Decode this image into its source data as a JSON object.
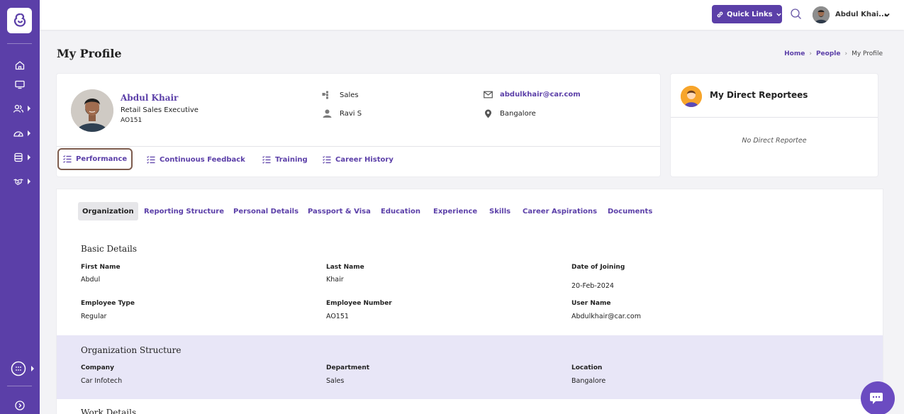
{
  "colors": {
    "brand": "#5b3fa8",
    "sidebar": "#5b3fa8",
    "band": "#e8e6f7",
    "active_border": "#7d5c4e"
  },
  "topbar": {
    "quick_links_label": "Quick Links",
    "user_name": "Abdul Khai..."
  },
  "page": {
    "title": "My Profile"
  },
  "breadcrumb": {
    "home": "Home",
    "people": "People",
    "current": "My Profile",
    "separator": "›"
  },
  "profile": {
    "name": "Abdul Khair",
    "job_title": "Retail Sales Executive",
    "employee_id": "AO151",
    "department": "Sales",
    "manager": "Ravi S",
    "email": "abdulkhair@car.com",
    "location": "Bangalore",
    "tabs": [
      "Performance",
      "Continuous Feedback",
      "Training",
      "Career History"
    ]
  },
  "reportees": {
    "title": "My Direct Reportees",
    "empty_text": "No Direct Reportee"
  },
  "details": {
    "tabs": [
      "Organization",
      "Reporting Structure",
      "Personal Details",
      "Passport & Visa",
      "Education",
      "Experience",
      "Skills",
      "Career Aspirations",
      "Documents"
    ],
    "basic": {
      "title": "Basic Details",
      "first_name_label": "First Name",
      "first_name": "Abdul",
      "last_name_label": "Last Name",
      "last_name": "Khair",
      "doj_label": "Date of Joining",
      "doj": "20-Feb-2024",
      "emp_type_label": "Employee Type",
      "emp_type": "Regular",
      "emp_no_label": "Employee Number",
      "emp_no": "AO151",
      "username_label": "User Name",
      "username": "Abdulkhair@car.com"
    },
    "org": {
      "title": "Organization Structure",
      "company_label": "Company",
      "company": "Car Infotech",
      "dept_label": "Department",
      "dept": "Sales",
      "location_label": "Location",
      "location": "Bangalore"
    },
    "work": {
      "title": "Work Details"
    }
  },
  "icons": {
    "sidebar": [
      "home-icon",
      "monitor-icon",
      "people-icon",
      "dashboard-icon",
      "database-icon",
      "handshake-icon",
      "menu-circle-icon",
      "expand-icon"
    ]
  }
}
